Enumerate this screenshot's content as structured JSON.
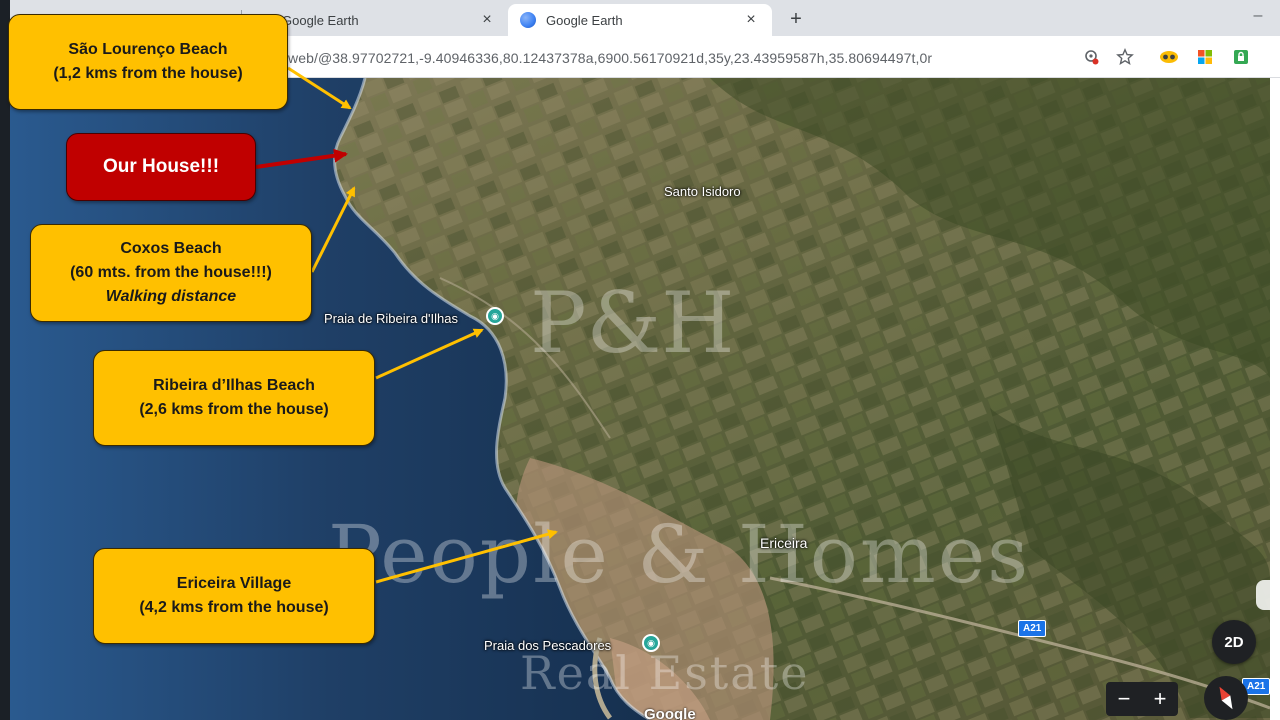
{
  "browser": {
    "tabs": [
      {
        "label": "Google Earth",
        "close": "×"
      },
      {
        "label": "Google Earth",
        "close": "×"
      }
    ],
    "new_tab": "+",
    "minimize": "–",
    "url": "web/@38.97702721,-9.40946336,80.12437378a,6900.56170921d,35y,23.43959587h,35.80694497t,0r",
    "toolbar_icons": [
      "location-icon",
      "star-icon",
      "extension-glasses-icon",
      "windows-icon",
      "lock-extension-icon"
    ]
  },
  "map": {
    "labels": {
      "santo_isidoro": "Santo Isidoro",
      "praia_ribeira": "Praia de Ribeira d'Ilhas",
      "ericeira": "Ericeira",
      "praia_pescadores": "Praia dos Pescadores"
    },
    "road_shields": [
      "A21",
      "A21"
    ],
    "watermark": {
      "monogram": "P&H",
      "title": "People & Homes",
      "subtitle": "Real Estate"
    },
    "controls": {
      "view_2d": "2D",
      "zoom_out": "−",
      "zoom_in": "+"
    },
    "logo": "Google"
  },
  "callouts": {
    "sao_lourenco": {
      "line1": "São Lourenço Beach",
      "line2": "(1,2 kms from the house)"
    },
    "our_house": {
      "line1": "Our House!!!"
    },
    "coxos": {
      "line1": "Coxos Beach",
      "line2": "(60 mts. from the house!!!)",
      "line3": "Walking distance"
    },
    "ribeira": {
      "line1": "Ribeira d’Ilhas Beach",
      "line2": "(2,6 kms from the house)"
    },
    "ericeira": {
      "line1": "Ericeira Village",
      "line2": "(4,2 kms from the house)"
    }
  },
  "colors": {
    "callout_yellow": "#ffc000",
    "callout_red": "#c00000",
    "arrow_yellow": "#ffc000",
    "arrow_red": "#c00000",
    "ocean": "#1f3f66",
    "land": "#6b6a45"
  }
}
